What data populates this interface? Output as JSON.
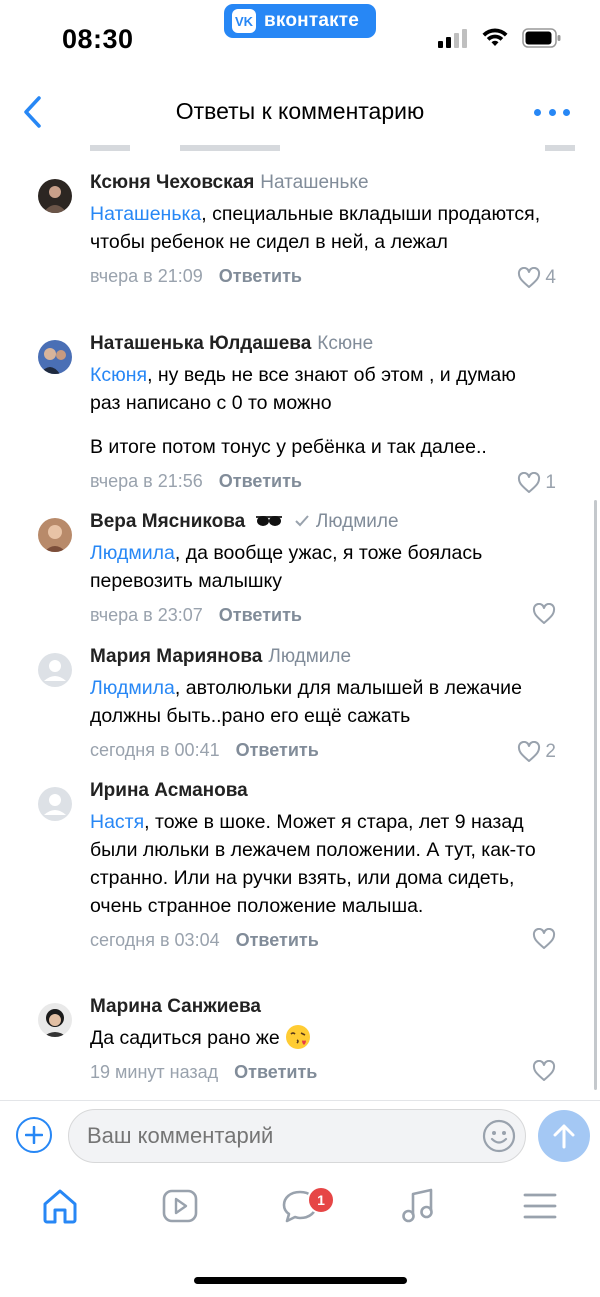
{
  "status_bar": {
    "time": "08:30",
    "app_pill_label": "вконтакте",
    "app_logo": "VK"
  },
  "header": {
    "title": "Ответы к комментарию"
  },
  "comments": [
    {
      "author": "Ксюня Чеховская",
      "reply_to": "Наташеньке",
      "mention": "Наташенька",
      "text": ", специальные вкладыши продаются, чтобы ребенок не сидел в ней, а лежал",
      "date": "вчера в 21:09",
      "reply_label": "Ответить",
      "likes": "4"
    },
    {
      "author": "Наташенька Юлдашева",
      "reply_to": "Ксюне",
      "mention": "Ксюня",
      "text": ", ну ведь не все знают об этом , и думаю раз написано с 0 то можно",
      "text2": "В итоге потом тонус у ребёнка и так далее..",
      "date": "вчера в 21:56",
      "reply_label": "Ответить",
      "likes": "1"
    },
    {
      "author": "Вера Мясникова",
      "reply_to": "Людмиле",
      "mention": "Людмила",
      "text": ", да вообще ужас, я тоже боялась перевозить малышку",
      "date": "вчера в 23:07",
      "reply_label": "Ответить",
      "likes": ""
    },
    {
      "author": "Мария Мариянова",
      "reply_to": "Людмиле",
      "mention": "Людмила",
      "text": ", автолюльки для малышей в лежачие должны быть..рано его ещё сажать",
      "date": "сегодня в 00:41",
      "reply_label": "Ответить",
      "likes": "2"
    },
    {
      "author": "Ирина Асманова",
      "reply_to": "",
      "mention": "Настя",
      "text": ", тоже в шоке. Может я стара, лет 9 назад были люльки в лежачем положении. А тут, как-то странно. Или на ручки взять, или дома сидеть, очень странное положение малыша.",
      "date": "сегодня в 03:04",
      "reply_label": "Ответить",
      "likes": ""
    },
    {
      "author": "Марина Санжиева",
      "reply_to": "",
      "mention": "",
      "text": "Да садиться рано же",
      "date": "19 минут назад",
      "reply_label": "Ответить",
      "likes": ""
    }
  ],
  "composer": {
    "placeholder": "Ваш комментарий"
  },
  "tab_bar": {
    "messages_badge": "1",
    "tabs": [
      "home-icon",
      "video-icon",
      "messages-icon",
      "music-icon",
      "menu-icon"
    ]
  },
  "colors": {
    "accent": "#2787f5",
    "secondary_text": "#818c99",
    "badge": "#e64646"
  }
}
